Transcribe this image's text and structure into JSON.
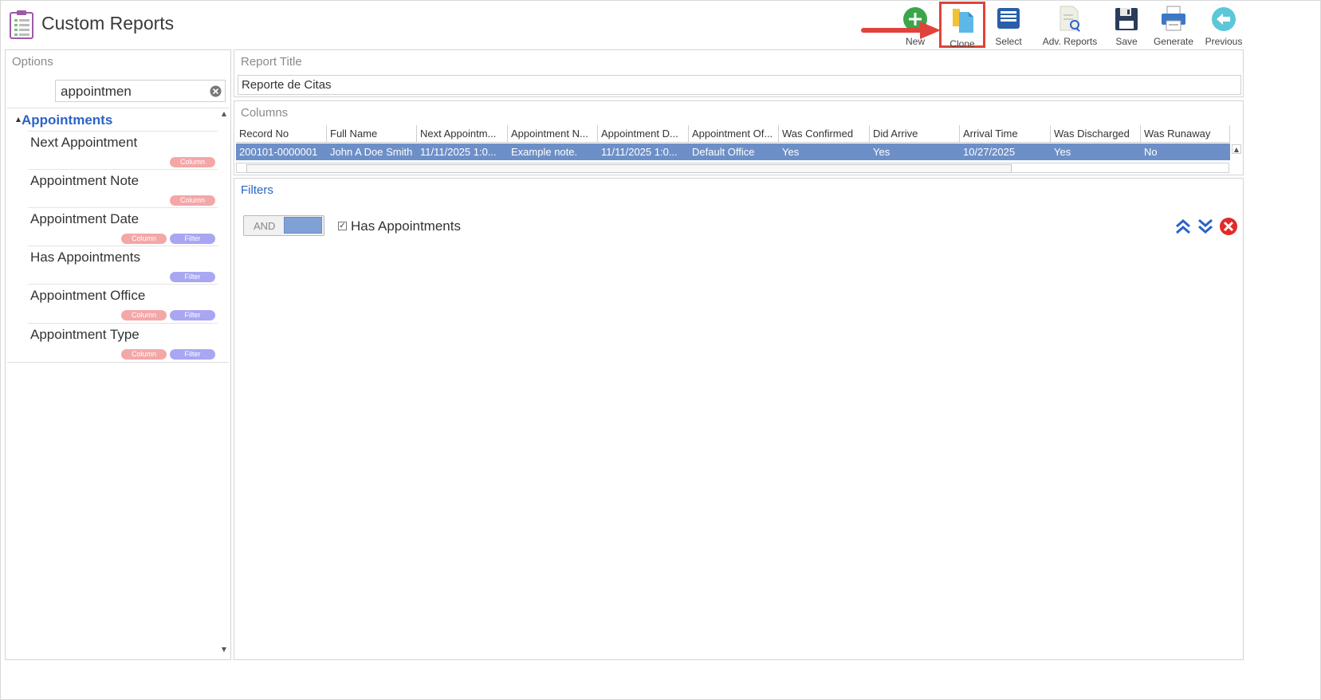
{
  "app": {
    "title": "Custom Reports"
  },
  "toolbar": {
    "new_label": "New",
    "clone_label": "Clone",
    "select_label": "Select",
    "adv_reports_label": "Adv. Reports",
    "save_label": "Save",
    "generate_label": "Generate",
    "previous_label": "Previous"
  },
  "options": {
    "title": "Options",
    "search_value": "appointmen",
    "group_label": "Appointments",
    "items": [
      {
        "label": "Next Appointment",
        "column": "Column",
        "filter": ""
      },
      {
        "label": "Appointment Note",
        "column": "Column",
        "filter": ""
      },
      {
        "label": "Appointment Date",
        "column": "Column",
        "filter": "Filter"
      },
      {
        "label": "Has Appointments",
        "column": "",
        "filter": "Filter"
      },
      {
        "label": "Appointment Office",
        "column": "Column",
        "filter": "Filter"
      },
      {
        "label": "Appointment Type",
        "column": "Column",
        "filter": "Filter"
      }
    ]
  },
  "report_title": {
    "label": "Report Title",
    "value": "Reporte de Citas"
  },
  "columns": {
    "label": "Columns",
    "headers": [
      "Record No",
      "Full Name",
      "Next Appointm...",
      "Appointment N...",
      "Appointment D...",
      "Appointment Of...",
      "Was Confirmed",
      "Did Arrive",
      "Arrival Time",
      "Was Discharged",
      "Was Runaway"
    ],
    "row": [
      "200101-0000001",
      "John A Doe Smith",
      "11/11/2025 1:0...",
      "Example note.",
      "11/11/2025 1:0...",
      "Default Office",
      "Yes",
      "Yes",
      "10/27/2025",
      "Yes",
      "No"
    ]
  },
  "filters": {
    "label": "Filters",
    "operator": "AND",
    "checkbox_label": "Has Appointments",
    "checkbox_checked": "✓"
  },
  "colors": {
    "accent": "#2a63c8",
    "selected_row": "#6d8fc8",
    "column_tag": "#f4a7a7",
    "filter_tag": "#a9a6f2",
    "highlight_box": "#e0433a"
  }
}
